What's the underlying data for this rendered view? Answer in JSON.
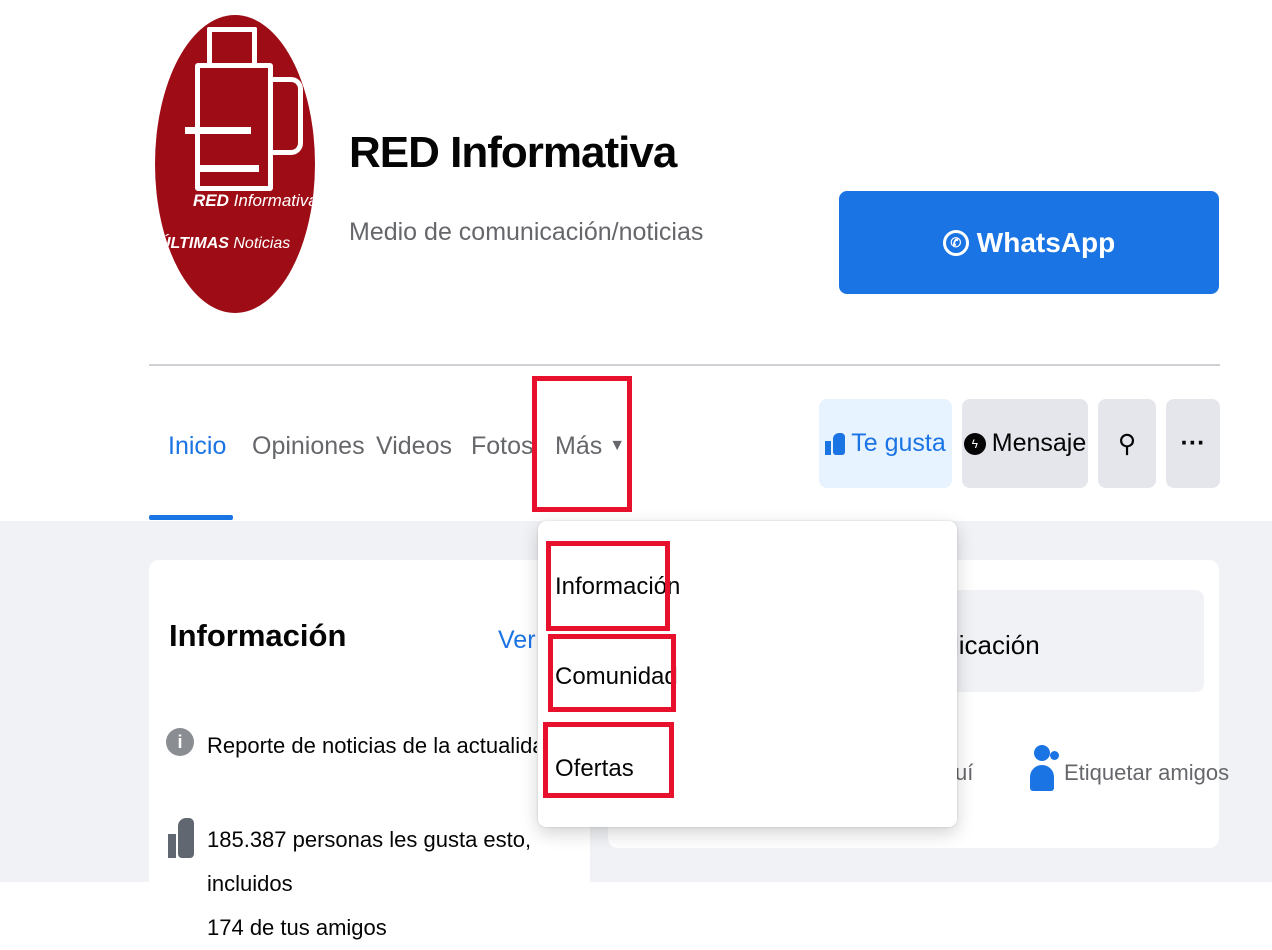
{
  "header": {
    "logo": {
      "line1_bold": "RED",
      "line1_rest": "Informativa",
      "line2_bold": "ÚLTIMAS",
      "line2_rest": "Noticias"
    },
    "page_name": "RED Informativa",
    "category": "Medio de comunicación/noticias",
    "whatsapp_label": "WhatsApp"
  },
  "tabs": [
    {
      "label": "Inicio",
      "active": true
    },
    {
      "label": "Opiniones"
    },
    {
      "label": "Videos"
    },
    {
      "label": "Fotos"
    },
    {
      "label": "Más",
      "caret": "▼"
    }
  ],
  "actions": {
    "like_label": "Te gusta",
    "message_label": "Mensaje",
    "search_icon": "⚲",
    "more_icon": "···"
  },
  "dropdown": {
    "items": [
      "Información",
      "Comunidad",
      "Ofertas"
    ]
  },
  "info_card": {
    "title": "Información",
    "see_all": "Ver t",
    "description": "Reporte de noticias de la actualidad Azu",
    "likes_line1": "185.387 personas les gusta esto, incluidos",
    "likes_line2": "174 de tus amigos"
  },
  "post_card": {
    "pill_text": "licación",
    "checkin_fragment": "uí",
    "tag_friends": "Etiquetar amigos"
  },
  "colors": {
    "brand_blue": "#1b74e4",
    "highlight_red": "#e8112d",
    "logo_red": "#9e0d16"
  }
}
